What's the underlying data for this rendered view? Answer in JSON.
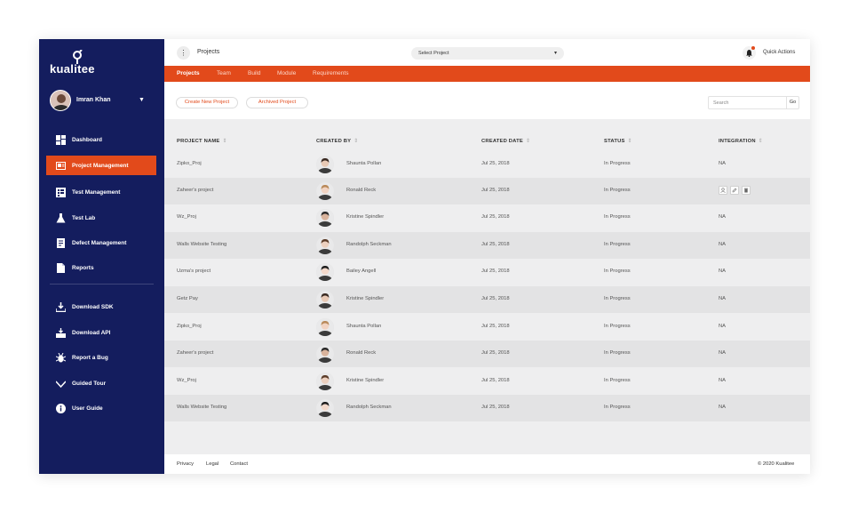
{
  "brand": {
    "logo_text": "kualitee"
  },
  "sidebar": {
    "user_name": "Imran Khan",
    "items": [
      {
        "label": "Dashboard",
        "icon": "dashboard-icon"
      },
      {
        "label": "Project Management",
        "icon": "project-management-icon",
        "active": true
      },
      {
        "label": "Test Management",
        "icon": "test-management-icon"
      },
      {
        "label": "Test Lab",
        "icon": "flask-icon"
      },
      {
        "label": "Defect Management",
        "icon": "defect-icon"
      },
      {
        "label": "Reports",
        "icon": "reports-icon"
      }
    ],
    "secondary_items": [
      {
        "label": "Download SDK",
        "icon": "download-icon"
      },
      {
        "label": "Download API",
        "icon": "api-download-icon"
      },
      {
        "label": "Report a Bug",
        "icon": "bug-icon"
      },
      {
        "label": "Guided Tour",
        "icon": "tour-icon"
      },
      {
        "label": "User Guide",
        "icon": "info-icon"
      }
    ]
  },
  "topbar": {
    "title": "Projects",
    "select_project": "Select Project",
    "quick_actions": "Quick Actions"
  },
  "tabs": [
    {
      "label": "Projects",
      "active": true
    },
    {
      "label": "Team"
    },
    {
      "label": "Build"
    },
    {
      "label": "Module"
    },
    {
      "label": "Requirements"
    }
  ],
  "actions": {
    "create": "Create New Project",
    "archived": "Archived Project",
    "search_placeholder": "Search",
    "go": "Go"
  },
  "table": {
    "columns": [
      "PROJECT NAME",
      "CREATED BY",
      "CREATED DATE",
      "STATUS",
      "INTEGRATION"
    ],
    "rows": [
      {
        "project": "Zipko_Proj",
        "created_by": "Shaunta Pollan",
        "date": "Jul 25, 2018",
        "status": "In Progress",
        "integration": "NA"
      },
      {
        "project": "Zaheer's project",
        "created_by": "Ronald Reck",
        "date": "Jul 25, 2018",
        "status": "In Progress",
        "integration": ""
      },
      {
        "project": "Wz_Proj",
        "created_by": "Kristine Spindler",
        "date": "Jul 25, 2018",
        "status": "In Progress",
        "integration": "NA"
      },
      {
        "project": "Walls Website Testing",
        "created_by": "Randolph Seckman",
        "date": "Jul 25, 2018",
        "status": "In Progress",
        "integration": "NA"
      },
      {
        "project": "Uzma's project",
        "created_by": "Bailey Angell",
        "date": "Jul 25, 2018",
        "status": "In Progress",
        "integration": "NA"
      },
      {
        "project": "Getz Pay",
        "created_by": "Kristine Spindler",
        "date": "Jul 25, 2018",
        "status": "In Progress",
        "integration": "NA"
      },
      {
        "project": "Zipko_Proj",
        "created_by": "Shaunta Pollan",
        "date": "Jul 25, 2018",
        "status": "In Progress",
        "integration": "NA"
      },
      {
        "project": "Zaheer's project",
        "created_by": "Ronald Reck",
        "date": "Jul 25, 2018",
        "status": "In Progress",
        "integration": "NA"
      },
      {
        "project": "Wz_Proj",
        "created_by": "Kristine Spindler",
        "date": "Jul 25, 2018",
        "status": "In Progress",
        "integration": "NA"
      },
      {
        "project": "Walls Website Testing",
        "created_by": "Randolph Seckman",
        "date": "Jul 25, 2018",
        "status": "In Progress",
        "integration": "NA"
      }
    ]
  },
  "footer": {
    "links": [
      "Privacy",
      "Legal",
      "Contact"
    ],
    "copyright": "© 2020  Kualitee"
  },
  "colors": {
    "sidebar": "#141d5e",
    "accent": "#e24a1b"
  }
}
